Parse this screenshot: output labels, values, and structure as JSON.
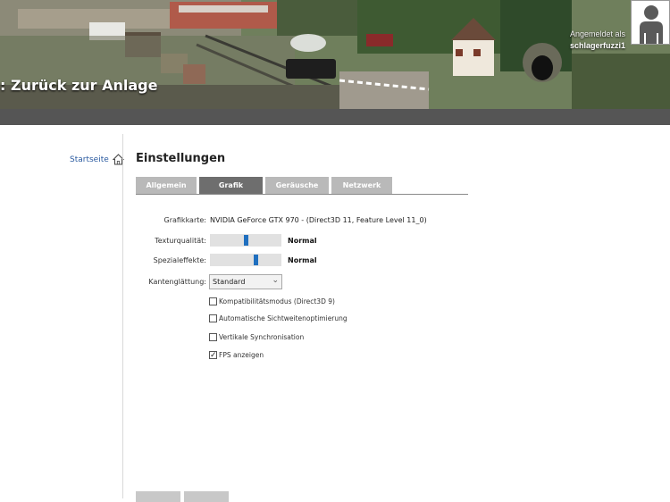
{
  "banner": {
    "back_label": ": Zurück zur Anlage",
    "user_label": "Angemeldet als",
    "user_name": "schlagerfuzzi1"
  },
  "sidebar": {
    "home_label": "Startseite",
    "home_icon": "house-icon"
  },
  "page": {
    "title": "Einstellungen",
    "tabs": [
      {
        "label": "Allgemein",
        "active": false
      },
      {
        "label": "Grafik",
        "active": true
      },
      {
        "label": "Geräusche",
        "active": false
      },
      {
        "label": "Netzwerk",
        "active": false
      }
    ]
  },
  "grafik": {
    "gpu_label": "Grafikkarte:",
    "gpu_value": "NVIDIA GeForce GTX 970 - (Direct3D 11, Feature Level 11_0)",
    "texture_label": "Texturqualität:",
    "texture_value": "Normal",
    "texture_level": 0.5,
    "effects_label": "Spezialeffekte:",
    "effects_value": "Normal",
    "effects_level": 0.65,
    "aa_label": "Kantenglättung:",
    "aa_value": "Standard",
    "checkboxes": [
      {
        "label": "Kompatibilitätsmodus (Direct3D 9)",
        "checked": false
      },
      {
        "label": "Automatische Sichtweitenoptimierung",
        "checked": false
      },
      {
        "label": "Vertikale Synchronisation",
        "checked": false
      },
      {
        "label": "FPS anzeigen",
        "checked": true
      }
    ]
  },
  "colors": {
    "accent": "#1f6fbf",
    "tab_active": "#6e6e6e",
    "tab_inactive": "#b9b9b9",
    "topbar": "#555555"
  }
}
